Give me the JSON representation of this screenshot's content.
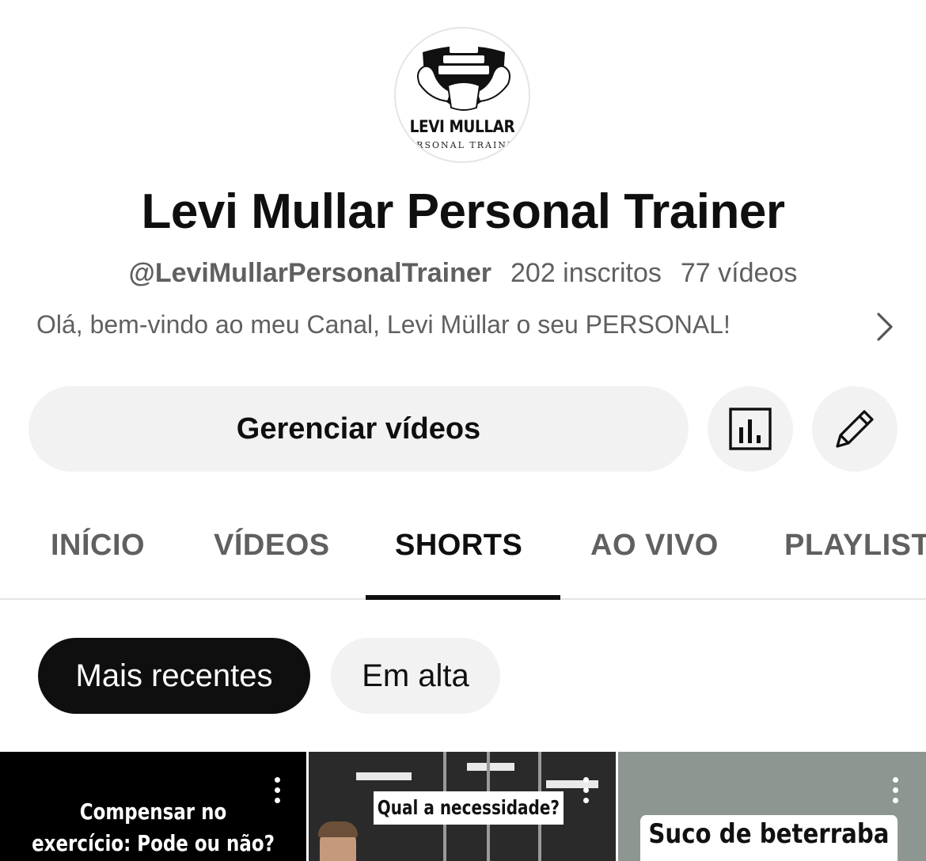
{
  "channel": {
    "avatar_logo_name": "LEVI MULLAR",
    "avatar_logo_subtitle": "PERSONAL TRAINER",
    "title": "Levi Mullar Personal Trainer",
    "handle": "@LeviMullarPersonalTrainer",
    "subscribers": "202 inscritos",
    "videos_count": "77 vídeos",
    "description": "Olá, bem-vindo ao meu Canal, Levi Müllar o seu PERSONAL!"
  },
  "actions": {
    "manage_label": "Gerenciar vídeos",
    "stats_icon": "bar-chart-icon",
    "edit_icon": "pencil-icon"
  },
  "tabs": [
    {
      "label": "INÍCIO",
      "active": false
    },
    {
      "label": "VÍDEOS",
      "active": false
    },
    {
      "label": "SHORTS",
      "active": true
    },
    {
      "label": "AO VIVO",
      "active": false
    },
    {
      "label": "PLAYLISTS",
      "active": false
    }
  ],
  "filters": {
    "recent_label": "Mais recentes",
    "trending_label": "Em alta",
    "selected": "Mais recentes"
  },
  "shorts": [
    {
      "caption_line1": "Compensar no",
      "caption_line2": "exercício: Pode ou não?"
    },
    {
      "caption": "Qual a necessidade?"
    },
    {
      "caption": "Suco de beterraba"
    }
  ],
  "colors": {
    "text_primary": "#0f0f0f",
    "text_secondary": "#606060",
    "chip_bg": "#f2f2f2",
    "chip_selected_bg": "#0f0f0f"
  }
}
